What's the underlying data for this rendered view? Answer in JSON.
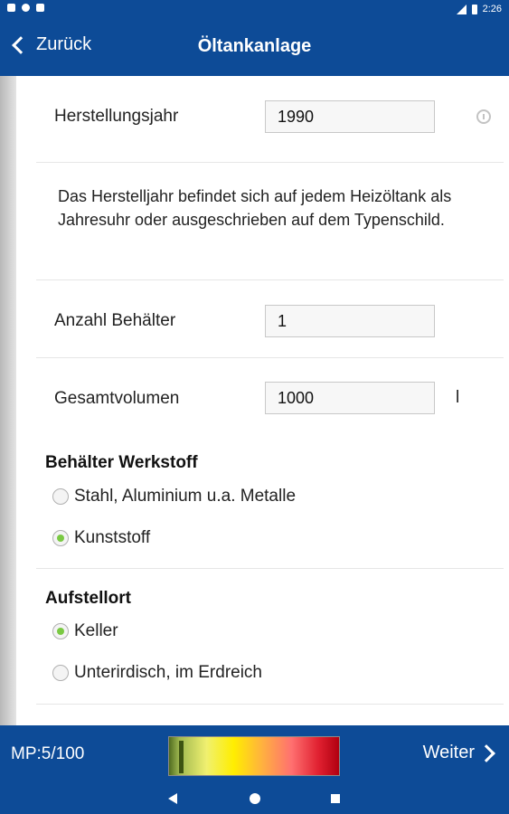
{
  "status_bar": {
    "time": "2:26"
  },
  "app_bar": {
    "back_label": "Zurück",
    "title": "Öltankanlage"
  },
  "form": {
    "year": {
      "label": "Herstellungsjahr",
      "value": "1990"
    },
    "help_text": "Das Herstelljahr befindet sich auf jedem Heizöltank als Jahresuhr oder ausgeschrieben auf dem Typenschild.",
    "count": {
      "label": "Anzahl Behälter",
      "value": "1"
    },
    "volume": {
      "label": "Gesamtvolumen",
      "value": "1000",
      "unit": "l"
    }
  },
  "material": {
    "title": "Behälter Werkstoff",
    "options": [
      {
        "label": "Stahl, Aluminium u.a. Metalle",
        "checked": false
      },
      {
        "label": "Kunststoff",
        "checked": true
      }
    ]
  },
  "location": {
    "title": "Aufstellort",
    "options": [
      {
        "label": "Keller",
        "checked": true
      },
      {
        "label": "Unterirdisch, im Erdreich",
        "checked": false
      }
    ]
  },
  "bottom_bar": {
    "mp_label": "MP:5/100",
    "progress": 0.05,
    "next_label": "Weiter"
  },
  "colors": {
    "brand": "#0d4b97",
    "radio_checked": "#7ac943"
  }
}
